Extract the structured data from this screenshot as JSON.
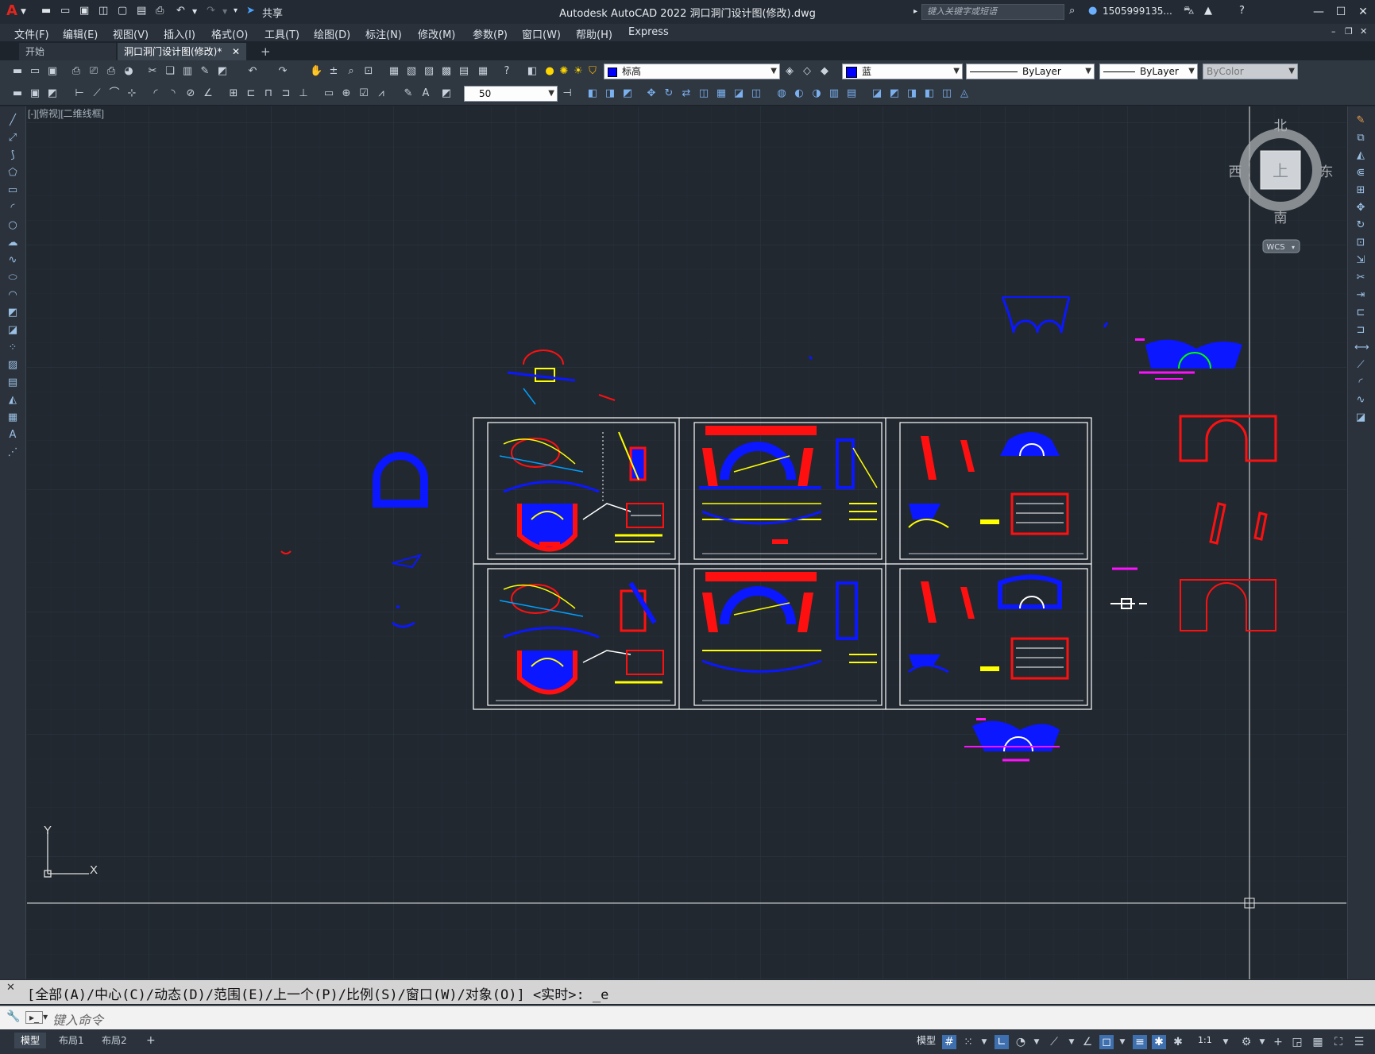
{
  "titlebar": {
    "title": "Autodesk AutoCAD 2022    洞口洞门设计图(修改).dwg",
    "share_label": "共享",
    "search_placeholder": "键入关键字或短语",
    "user": "1505999135...",
    "app_icon": "A"
  },
  "menu": [
    "文件(F)",
    "编辑(E)",
    "视图(V)",
    "插入(I)",
    "格式(O)",
    "工具(T)",
    "绘图(D)",
    "标注(N)",
    "修改(M)",
    "参数(P)",
    "窗口(W)",
    "帮助(H)",
    "Express"
  ],
  "tabs": {
    "start": "开始",
    "doc": "洞口洞门设计图(修改)*",
    "add": "+"
  },
  "properties": {
    "layer": "标高",
    "color_name": "蓝",
    "color_hex": "#0000ff",
    "linetype": "ByLayer",
    "lineweight": "ByLayer",
    "plotstyle": "ByColor",
    "text_height": "50"
  },
  "viewport": {
    "label": "[-][俯视][二维线框]"
  },
  "viewcube": {
    "north": "北",
    "south": "南",
    "east": "东",
    "west": "西",
    "face": "上",
    "wcs": "WCS"
  },
  "ucs": {
    "x_label": "X",
    "y_label": "Y"
  },
  "command": {
    "history": "[全部(A)/中心(C)/动态(D)/范围(E)/上一个(P)/比例(S)/窗口(W)/对象(O)] <实时>: _e",
    "placeholder": "键入命令"
  },
  "layout_tabs": [
    "模型",
    "布局1",
    "布局2"
  ],
  "status": {
    "model_label": "模型",
    "scale": "1:1"
  },
  "colors": {
    "drawing_blue": "#0b17ff",
    "drawing_red": "#ff1010",
    "drawing_yellow": "#ffff00",
    "drawing_magenta": "#ff10ff",
    "drawing_white": "#ffffff",
    "background": "#212830"
  }
}
